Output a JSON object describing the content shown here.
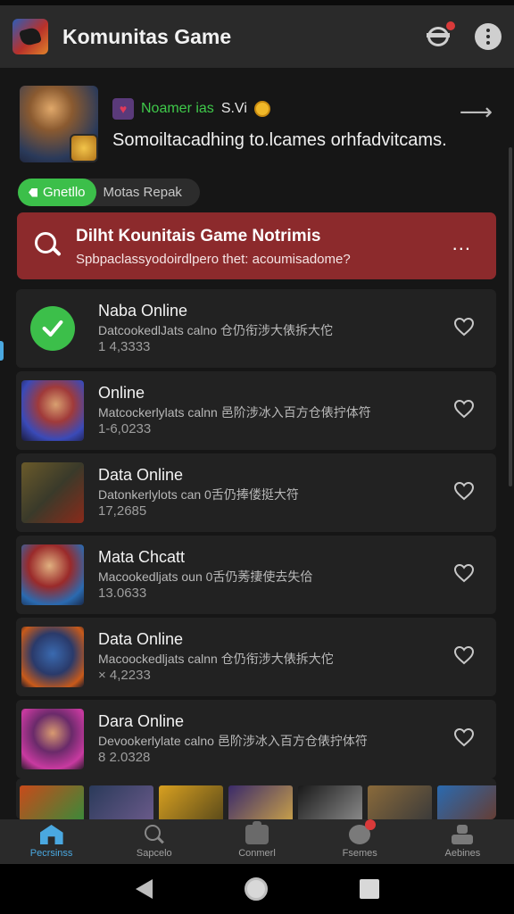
{
  "app": {
    "title": "Komunitas Game"
  },
  "featured": {
    "name": "Noamer ias",
    "tag": "S.Vi",
    "description": "Somoiltacadhing to.lcames orhfadvitcams."
  },
  "chips": {
    "active": "Gnetllo",
    "inactive": "Motas Repak"
  },
  "alert": {
    "title": "Dilht Kounitais Game  Notrimis",
    "subtitle": "Spbpaclassyodoirdlpero thet: acoumisadome?",
    "more": "..."
  },
  "list": [
    {
      "title": "Naba Online",
      "subtitle": "Datcookedl​Jats calno 仓仍衔涉大俵拆大佗",
      "count": "1 4,3333",
      "thumb": "check"
    },
    {
      "title": "Online",
      "subtitle": "Matcockerlylats calnn 邑阶涉冰入百方仓俵拧体符",
      "count": "1-6,0233",
      "thumb": "art1"
    },
    {
      "title": "Data Online",
      "subtitle": "Datonkerlylots can 0舌仍捧偻挺大符",
      "count": "17,2685",
      "thumb": "art2"
    },
    {
      "title": "Mata Chcatt",
      "subtitle": "Macookedljats oun 0舌仍莠捿使去失佮",
      "count": "13.0633",
      "thumb": "art3"
    },
    {
      "title": "Data Online",
      "subtitle": "Macoockedljats calnn 仓仍衔涉大俵拆大佗",
      "count": "× 4,2233",
      "thumb": "art4"
    },
    {
      "title": "Dara Online",
      "subtitle": "Devookerlylate calno 邑阶涉冰入百方仓俵拧体符",
      "count": "8 2.0328",
      "thumb": "art5"
    }
  ],
  "tabs": [
    {
      "label": "Pecrsinss",
      "icon": "home-icon",
      "active": true
    },
    {
      "label": "Sapcelo",
      "icon": "search-icon",
      "active": false
    },
    {
      "label": "Conmerl",
      "icon": "gamepad-icon",
      "active": false
    },
    {
      "label": "Fsemes",
      "icon": "notification-icon",
      "active": false,
      "badge": "!"
    },
    {
      "label": "Aebines",
      "icon": "account-icon",
      "active": false
    }
  ],
  "colors": {
    "accent_green": "#3cbf4a",
    "alert_red": "#8c2a2c",
    "tab_active": "#4aa8e0",
    "background": "#161616"
  }
}
